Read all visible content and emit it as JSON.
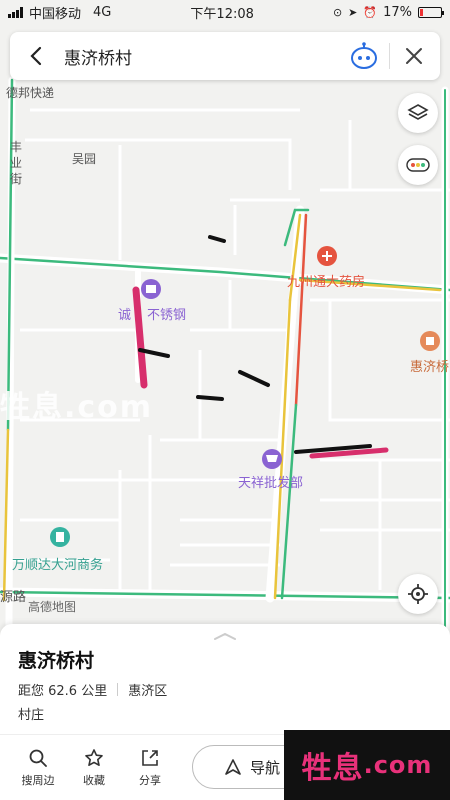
{
  "status": {
    "carrier": "中国移动",
    "network": "4G",
    "time": "下午12:08",
    "battery": "17%",
    "battery_level": 0.17
  },
  "search": {
    "query": "惠济桥村"
  },
  "map": {
    "road_labels": [
      "德邦快递",
      "吴园",
      "丰",
      "业",
      "街",
      "源路",
      "高德地图"
    ],
    "pois": [
      {
        "name": "九州通大药房",
        "icon": "pharmacy-pin-icon",
        "color": "#e5543f"
      },
      {
        "name": "诚",
        "icon": "shop-pin-icon",
        "color": "#8a63d2"
      },
      {
        "name": "不锈钢",
        "icon": "",
        "color": "#8a63d2"
      },
      {
        "name": "惠济桥",
        "icon": "landmark-pin-icon",
        "color": "#e58a5a"
      },
      {
        "name": "天祥批发部",
        "icon": "cart-pin-icon",
        "color": "#8a63d2"
      },
      {
        "name": "万顺达大河商务",
        "icon": "building-pin-icon",
        "color": "#35b3a0"
      }
    ],
    "watermark": "牲息.com"
  },
  "place": {
    "name": "惠济桥村",
    "distance": "距您 62.6 公里",
    "district": "惠济区",
    "category": "村庄"
  },
  "actions": {
    "nearby": "搜周边",
    "favorite": "收藏",
    "share": "分享",
    "navigate": "导航"
  },
  "watermark": {
    "text_a": "牲息",
    "text_b": ".com"
  }
}
